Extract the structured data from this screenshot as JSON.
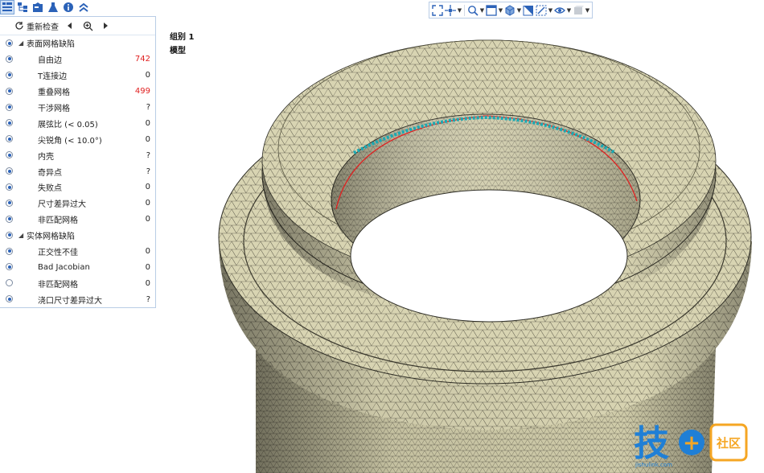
{
  "tabs": [
    {
      "icon": "tree-icon"
    },
    {
      "icon": "hierarchy-icon"
    },
    {
      "icon": "layers-icon"
    },
    {
      "icon": "flask-icon"
    },
    {
      "icon": "info-icon"
    },
    {
      "icon": "collapse-icon"
    }
  ],
  "panel": {
    "recheck_label": "重新检查",
    "groups": [
      {
        "label": "表面网格缺陷",
        "checked": true,
        "items": [
          {
            "label": "自由边",
            "value": "742",
            "checked": true,
            "highlight": true
          },
          {
            "label": "T连接边",
            "value": "0",
            "checked": true,
            "highlight": false
          },
          {
            "label": "重叠网格",
            "value": "499",
            "checked": true,
            "highlight": true
          },
          {
            "label": "干涉网格",
            "value": "?",
            "checked": true,
            "highlight": false
          },
          {
            "label": "展弦比 (< 0.05)",
            "value": "0",
            "checked": true,
            "highlight": false
          },
          {
            "label": "尖锐角 (< 10.0°)",
            "value": "0",
            "checked": true,
            "highlight": false
          },
          {
            "label": "内壳",
            "value": "?",
            "checked": true,
            "highlight": false
          },
          {
            "label": "奇异点",
            "value": "?",
            "checked": true,
            "highlight": false
          },
          {
            "label": "失败点",
            "value": "0",
            "checked": true,
            "highlight": false
          },
          {
            "label": "尺寸差异过大",
            "value": "0",
            "checked": true,
            "highlight": false
          },
          {
            "label": "非匹配网格",
            "value": "0",
            "checked": true,
            "highlight": false
          }
        ]
      },
      {
        "label": "实体网格缺陷",
        "checked": true,
        "items": [
          {
            "label": "正交性不佳",
            "value": "0",
            "checked": true,
            "highlight": false
          },
          {
            "label": "Bad Jacobian",
            "value": "0",
            "checked": true,
            "highlight": false
          },
          {
            "label": "非匹配网格",
            "value": "0",
            "checked": false,
            "highlight": false
          },
          {
            "label": "浇口尺寸差异过大",
            "value": "?",
            "checked": true,
            "highlight": false
          }
        ]
      }
    ]
  },
  "viewport": {
    "group_label": "组别 1",
    "model_label": "模型"
  },
  "toolbar": [
    "fit-view-icon",
    "pan-icon",
    "zoom-icon",
    "window-icon",
    "cube-icon",
    "plane-icon",
    "section-icon",
    "eye-icon",
    "display-icon"
  ],
  "watermark": {
    "char": "技",
    "plus": "+",
    "box": "社区",
    "url": "jishulink.com"
  },
  "colors": {
    "accent": "#2b62b8",
    "mesh": "#d8d4b2",
    "edge": "#333",
    "free_edge": "#e02020",
    "overlap": "#1ba9b3",
    "wm_blue": "#1f7fd6",
    "wm_orange": "#f5a623"
  }
}
